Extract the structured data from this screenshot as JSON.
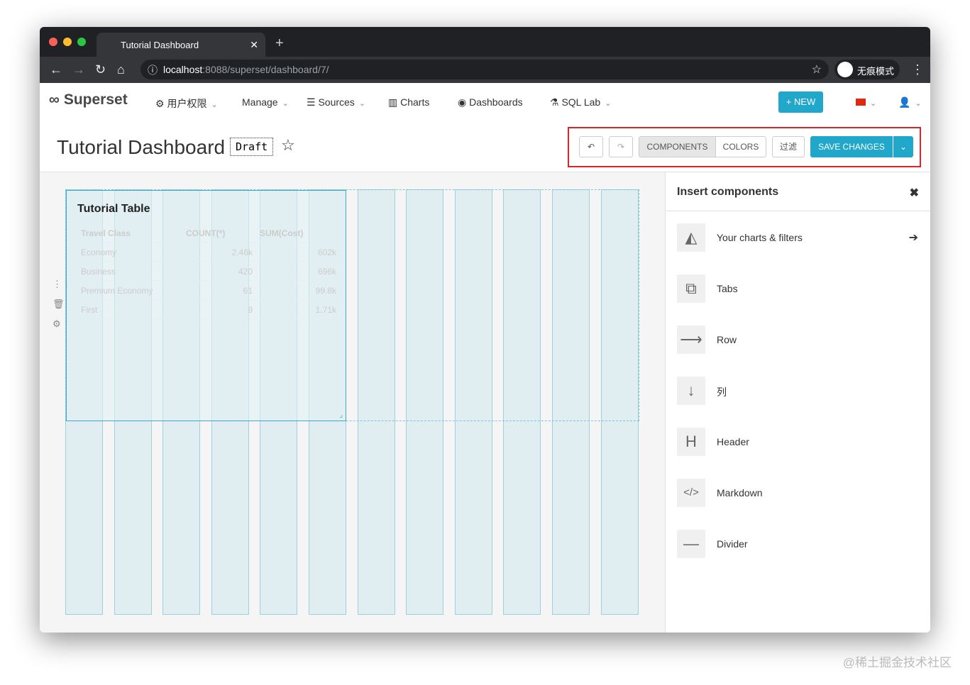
{
  "browser": {
    "tab_title": "Tutorial Dashboard",
    "url_host": "localhost",
    "url_path": ":8088/superset/dashboard/7/",
    "incognito_label": "无痕模式"
  },
  "navbar": {
    "brand": "Superset",
    "items": [
      {
        "label": "用户权限"
      },
      {
        "label": "Manage"
      },
      {
        "label": "Sources"
      },
      {
        "label": "Charts"
      },
      {
        "label": "Dashboards"
      },
      {
        "label": "SQL Lab"
      }
    ],
    "new_label": "NEW"
  },
  "header": {
    "title": "Tutorial Dashboard",
    "status": "Draft",
    "components_label": "COMPONENTS",
    "colors_label": "COLORS",
    "filter_label": "过滤",
    "save_label": "SAVE CHANGES"
  },
  "chart": {
    "title": "Tutorial Table",
    "columns": [
      "Travel Class",
      "COUNT(*)",
      "SUM(Cost)"
    ],
    "rows": [
      [
        "Economy",
        "2.46k",
        "602k"
      ],
      [
        "Business",
        "420",
        "696k"
      ],
      [
        "Premium Economy",
        "61",
        "99.8k"
      ],
      [
        "First",
        "9",
        "1.71k"
      ]
    ]
  },
  "panel": {
    "title": "Insert components",
    "items": [
      {
        "label": "Your charts & filters"
      },
      {
        "label": "Tabs"
      },
      {
        "label": "Row"
      },
      {
        "label": "列"
      },
      {
        "label": "Header"
      },
      {
        "label": "Markdown"
      },
      {
        "label": "Divider"
      }
    ]
  },
  "watermark": "@稀土掘金技术社区"
}
